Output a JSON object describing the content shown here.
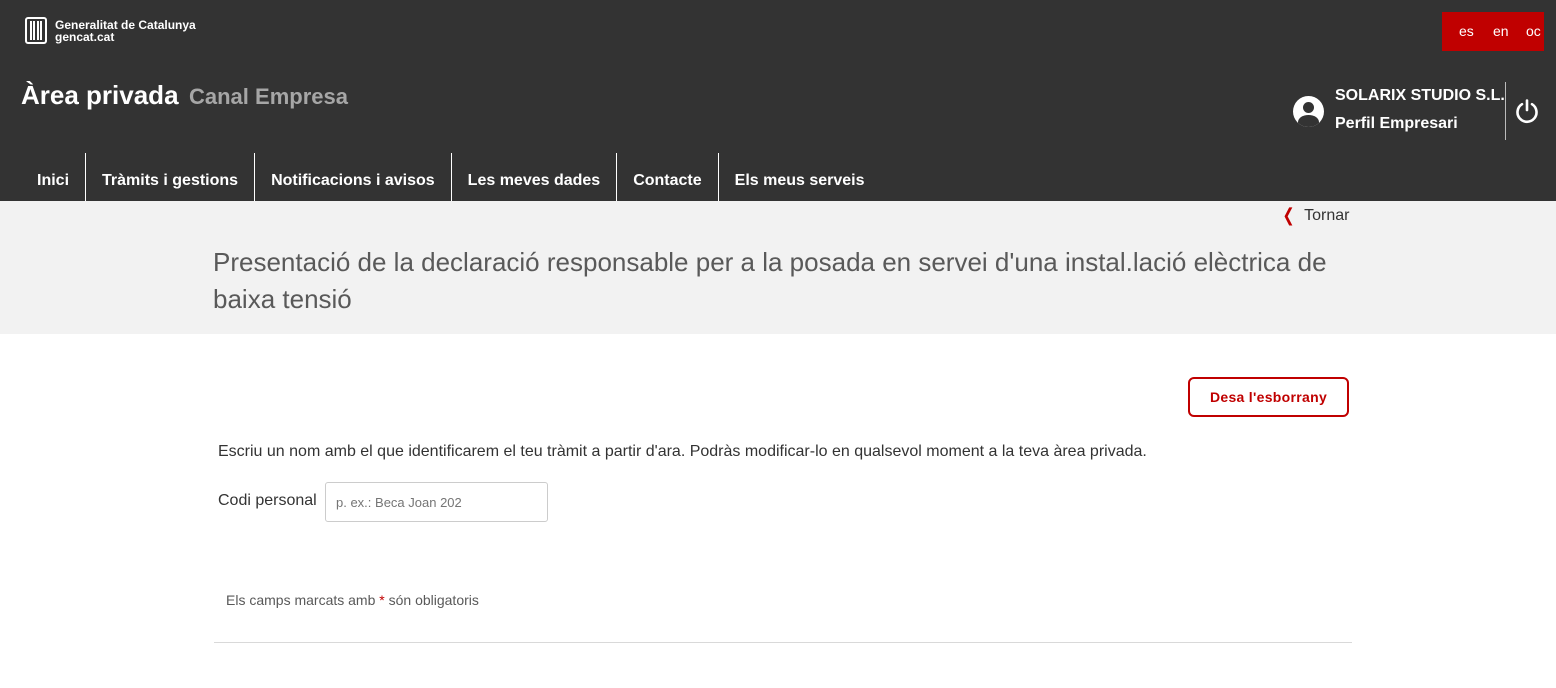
{
  "header": {
    "logo": {
      "line1": "Generalitat de Catalunya",
      "line2": "gencat.cat",
      "icon": "generalitat-logo-icon"
    },
    "languages": [
      "es",
      "en",
      "oc"
    ],
    "area_title": "Àrea privada",
    "area_subtitle": "Canal Empresa",
    "user": {
      "company": "SOLARIX STUDIO S.L.",
      "profile": "Perfil Empresari",
      "icon": "user-account-icon",
      "logout_icon": "power-icon"
    },
    "nav": [
      "Inici",
      "Tràmits i gestions",
      "Notificacions i avisos",
      "Les meves dades",
      "Contacte",
      "Els meus serveis"
    ]
  },
  "page": {
    "back_label": "Tornar",
    "title": "Presentació de la declaració responsable per a la posada en servei d'una instal.lació elèctrica de baixa tensió"
  },
  "form": {
    "save_draft_label": "Desa l'esborrany",
    "intro": "Escriu un nom amb el que identificarem el teu tràmit a partir d'ara. Podràs modificar-lo en qualsevol moment a la teva àrea privada.",
    "code_label": "Codi personal",
    "code_placeholder": "p. ex.: Beca Joan 202",
    "code_value": "",
    "required_note_before": "Els camps marcats amb",
    "required_asterisk": "*",
    "required_note_after": "són obligatoris"
  },
  "colors": {
    "header_bg": "#333333",
    "accent_red": "#c00000",
    "title_band_bg": "#f2f2f2"
  }
}
